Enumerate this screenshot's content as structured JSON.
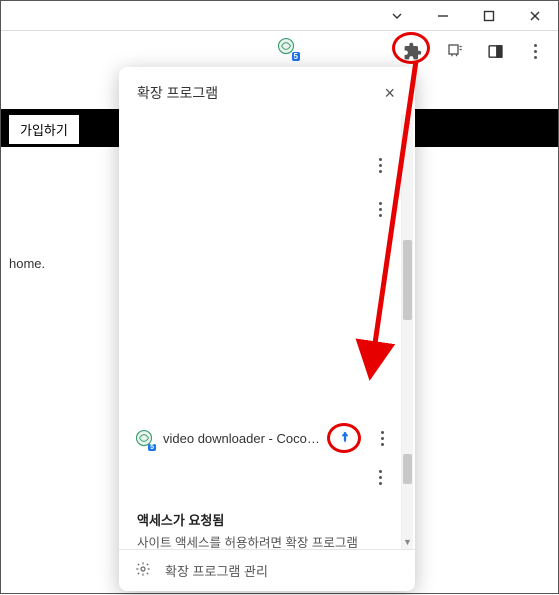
{
  "titlebar": {},
  "toolbar": {
    "ext_badge": "5"
  },
  "background": {
    "signup": "가입하기",
    "home": "home."
  },
  "popup": {
    "title": "확장 프로그램",
    "main_ext": {
      "name": "video downloader - CocoCut",
      "badge": "5"
    },
    "access": {
      "heading": "액세스가 요청됨",
      "desc": "사이트 액세스를 허용하려면 확장 프로그램을 클릭하세요."
    },
    "footer": "확장 프로그램 관리"
  }
}
